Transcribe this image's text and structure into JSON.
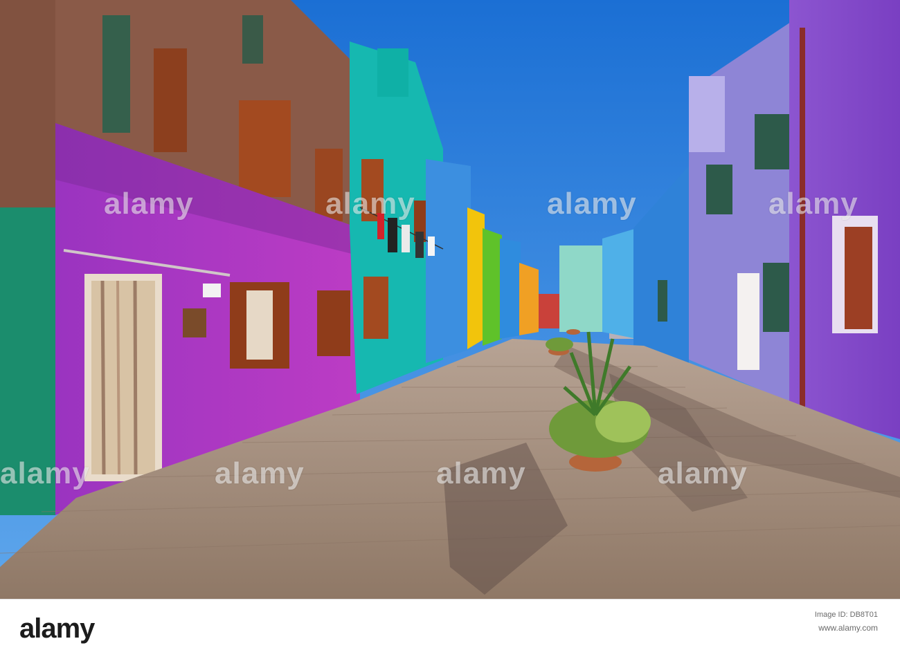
{
  "watermark": {
    "text": "alamy",
    "color": "#ffffff"
  },
  "footer": {
    "logo": "alamy",
    "image_id_label": "Image ID: DB8T01",
    "site": "www.alamy.com"
  },
  "scene": {
    "sky_color": "#1b73d6",
    "pavement_color": "#a58a76",
    "house_colors": {
      "brick": "#8a5a48",
      "magenta": "#a43ac8",
      "teal": "#16b8b0",
      "blue": "#3c8fe0",
      "yellow": "#f2c40c",
      "green": "#5fc22a",
      "lavender": "#8e85d6",
      "purple": "#8a4fc9",
      "left_green": "#1b8d6d"
    }
  }
}
